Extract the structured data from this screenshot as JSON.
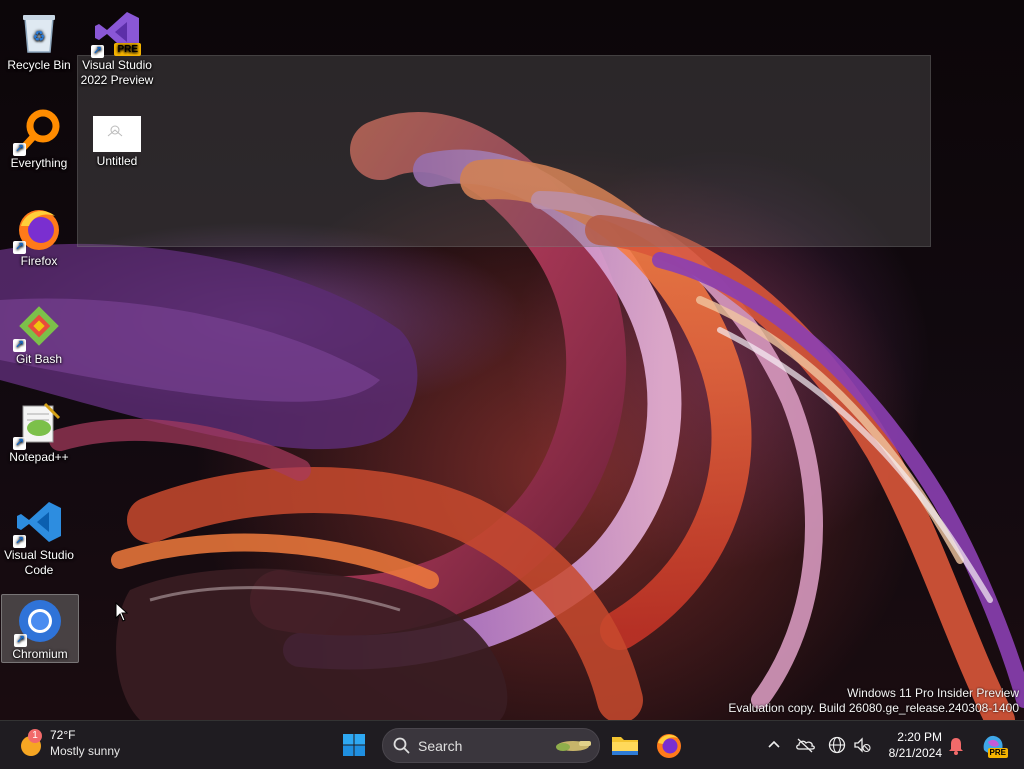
{
  "desktop": {
    "icons": [
      {
        "label": "Recycle Bin",
        "icon": "recycle-bin-icon"
      },
      {
        "label": "Visual Studio 2022 Preview",
        "line1": "Visual Studio",
        "line2": "2022 Preview",
        "icon": "visual-studio-icon",
        "badge": "PRE"
      },
      {
        "label": "Everything",
        "icon": "everything-search-icon"
      },
      {
        "label": "Untitled",
        "icon": "image-file-icon"
      },
      {
        "label": "Firefox",
        "icon": "firefox-icon"
      },
      {
        "label": "Git Bash",
        "icon": "git-bash-icon"
      },
      {
        "label": "Notepad++",
        "icon": "notepad-plus-plus-icon"
      },
      {
        "label": "Visual Studio Code",
        "line1": "Visual Studio",
        "line2": "Code",
        "icon": "vscode-icon"
      },
      {
        "label": "Chromium",
        "icon": "chromium-icon"
      }
    ],
    "selected_icon": "Chromium"
  },
  "watermark": {
    "line1": "Windows 11 Pro Insider Preview",
    "line2": "Evaluation copy. Build 26080.ge_release.240308-1400"
  },
  "taskbar": {
    "weather": {
      "temp": "72°F",
      "desc": "Mostly sunny",
      "badge": "1"
    },
    "search": {
      "label": "Search"
    },
    "pinned": [
      "file-explorer-icon",
      "firefox-icon"
    ],
    "tray": {
      "icons": [
        "chevron-up-icon",
        "onedrive-icon",
        "network-icon",
        "volume-muted-icon",
        "notification-bell-icon",
        "copilot-icon"
      ],
      "copilot_badge": "PRE"
    },
    "clock": {
      "time": "2:20 PM",
      "date": "8/21/2024"
    }
  },
  "colors": {
    "taskbar_bg": "#1f1c21",
    "search_bg": "#3a363d",
    "accent_blue": "#0078d4",
    "selection": "#6e6e6e"
  }
}
